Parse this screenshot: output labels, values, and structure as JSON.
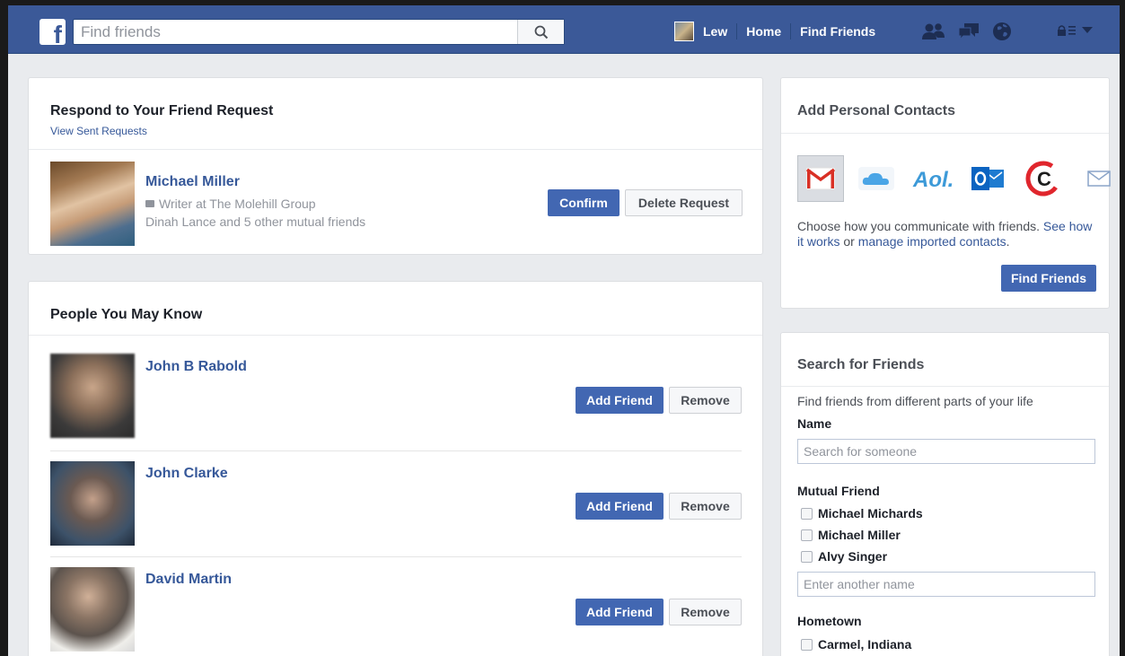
{
  "topbar": {
    "logo": "f",
    "search_placeholder": "Find friends",
    "user_name": "Lew",
    "home_label": "Home",
    "find_friends_label": "Find Friends",
    "colors": {
      "bar": "#3b5998",
      "text": "#ffffff"
    },
    "icons": [
      "search-icon",
      "friend-requests-icon",
      "messages-icon",
      "notifications-globe-icon",
      "privacy-lock-icon",
      "menu-caret-icon"
    ]
  },
  "friend_request": {
    "title": "Respond to Your Friend Request",
    "view_sent": "View Sent Requests",
    "person": {
      "name": "Michael Miller",
      "work": "Writer at The Molehill Group",
      "mutual": "Dinah Lance and 5 other mutual friends"
    },
    "confirm_label": "Confirm",
    "delete_label": "Delete Request"
  },
  "people_you_may_know": {
    "title": "People You May Know",
    "add_label": "Add Friend",
    "remove_label": "Remove",
    "people": [
      {
        "name": "John B Rabold"
      },
      {
        "name": "John Clarke"
      },
      {
        "name": "David Martin"
      }
    ]
  },
  "personal_contacts": {
    "title": "Add Personal Contacts",
    "providers": [
      "gmail-icon",
      "icloud-icon",
      "aol-icon",
      "outlook-icon",
      "comcast-icon",
      "other-email-icon"
    ],
    "description_pre": "Choose how you communicate with friends.",
    "see_how": "See how it works",
    "or": "or",
    "manage": "manage imported contacts",
    "period": ".",
    "button_label": "Find Friends"
  },
  "search_friends": {
    "title": "Search for Friends",
    "intro": "Find friends from different parts of your life",
    "name_label": "Name",
    "name_placeholder": "Search for someone",
    "mutual_label": "Mutual Friend",
    "mutual_options": [
      "Michael Michards",
      "Michael Miller",
      "Alvy Singer"
    ],
    "other_placeholder": "Enter another name",
    "hometown_label": "Hometown",
    "hometown_options": [
      "Carmel, Indiana"
    ]
  }
}
